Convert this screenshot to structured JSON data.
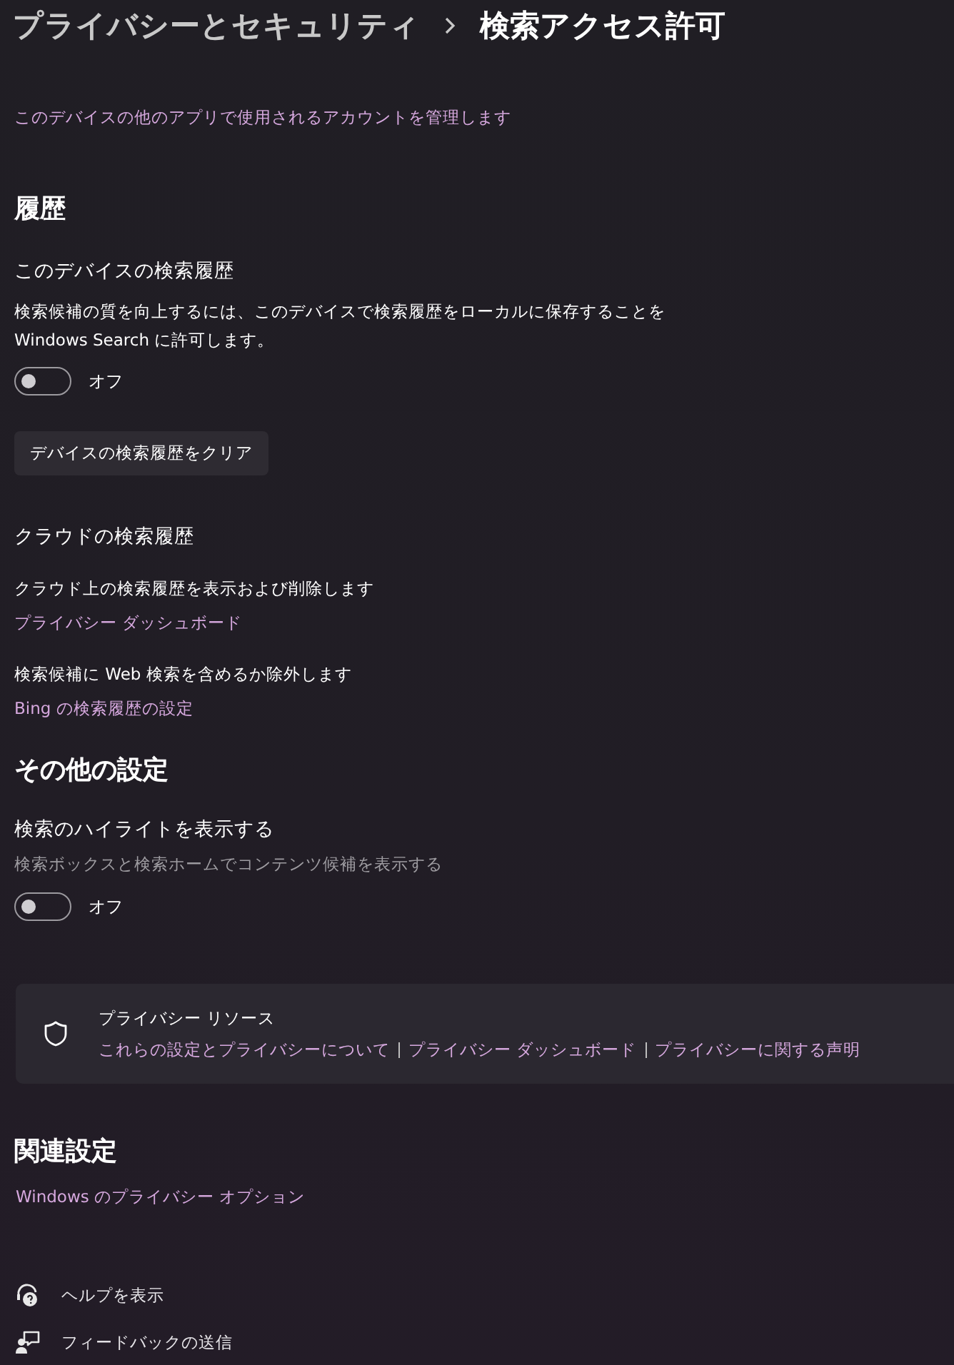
{
  "breadcrumb": {
    "parent": "プライバシーとセキュリティ",
    "current": "検索アクセス許可"
  },
  "manage_link": "このデバイスの他のアプリで使用されるアカウントを管理します",
  "history": {
    "heading": "履歴",
    "device_history": {
      "title": "このデバイスの検索履歴",
      "description": "検索候補の質を向上するには、このデバイスで検索履歴をローカルに保存することを Windows Search に許可します。",
      "toggle": {
        "on": false,
        "label": "オフ"
      }
    },
    "clear_button": "デバイスの検索履歴をクリア",
    "cloud_history": {
      "title": "クラウドの検索履歴",
      "items": [
        {
          "text": "クラウド上の検索履歴を表示および削除します",
          "link": "プライバシー ダッシュボード"
        },
        {
          "text": "検索候補に Web 検索を含めるか除外します",
          "link": "Bing の検索履歴の設定"
        }
      ]
    }
  },
  "other_settings": {
    "heading": "その他の設定",
    "highlights": {
      "title": "検索のハイライトを表示する",
      "description": "検索ボックスと検索ホームでコンテンツ候補を表示する",
      "toggle": {
        "on": false,
        "label": "オフ"
      }
    }
  },
  "privacy_resources": {
    "title": "プライバシー リソース",
    "links": [
      "これらの設定とプライバシーについて",
      "プライバシー ダッシュボード",
      "プライバシーに関する声明"
    ]
  },
  "related_settings": {
    "heading": "関連設定",
    "links": [
      "Windows のプライバシー オプション"
    ]
  },
  "footer_links": [
    {
      "kind": "help",
      "label": "ヘルプを表示"
    },
    {
      "kind": "feedback",
      "label": "フィードバックの送信"
    }
  ]
}
